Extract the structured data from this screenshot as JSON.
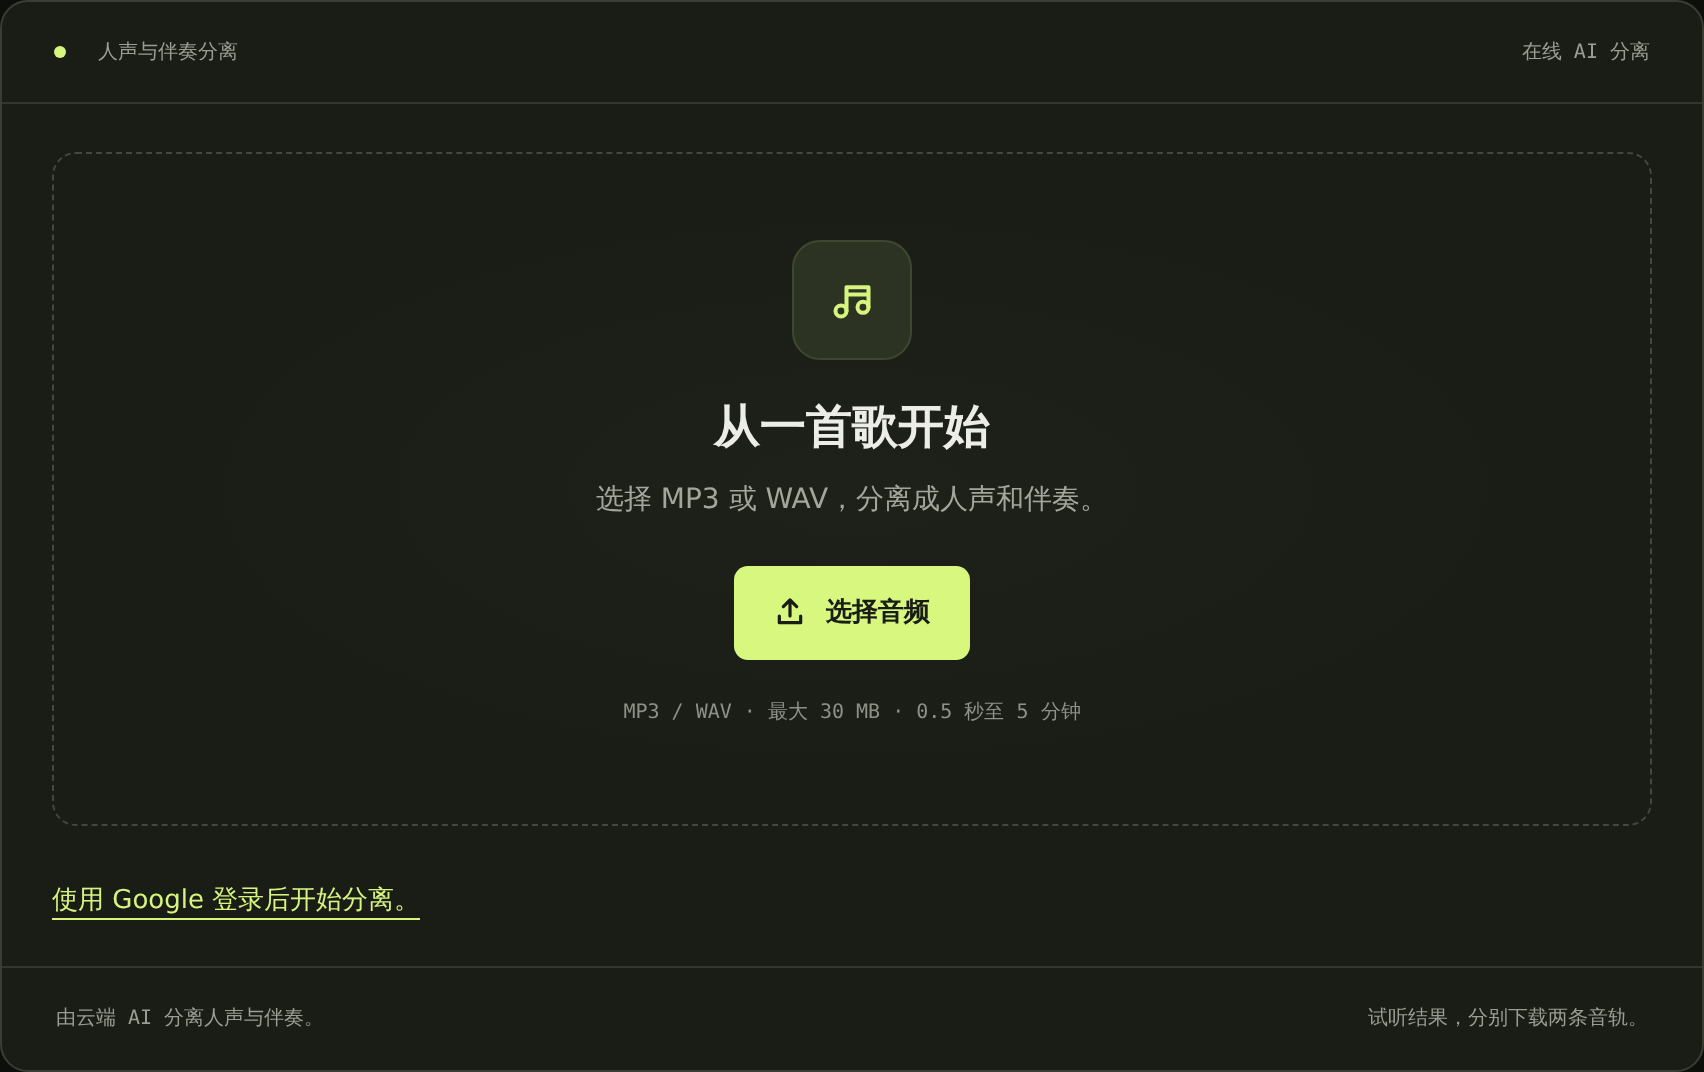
{
  "header": {
    "title": "人声与伴奏分离",
    "tag": "在线 AI 分离"
  },
  "upload": {
    "heading": "从一首歌开始",
    "description": "选择 MP3 或 WAV，分离成人声和伴奏。",
    "button": "选择音频",
    "limits": "MP3 / WAV · 最大 30 MB · 0.5 秒至 5 分钟"
  },
  "login_link": "使用 Google 登录后开始分离。",
  "footer": {
    "left": "由云端 AI 分离人声与伴奏。",
    "right": "试听结果，分别下载两条音轨。"
  }
}
